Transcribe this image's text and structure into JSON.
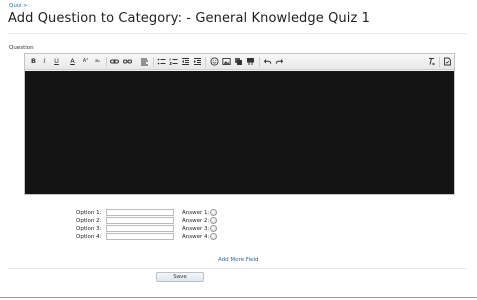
{
  "breadcrumb": {
    "link": "Quiz",
    "sep": ">"
  },
  "page": {
    "title": "Add Question to Category: - General Knowledge Quiz 1"
  },
  "question": {
    "label": "Question"
  },
  "toolbar": {
    "bold": "B",
    "italic": "I",
    "underline": "U",
    "font_color": "A",
    "superscript": "A²",
    "subscript": "a₂",
    "icons": [
      "link-icon",
      "unlink-icon",
      "align-icon",
      "bulleted-list-icon",
      "numbered-list-icon",
      "outdent-icon",
      "indent-icon",
      "smiley-icon",
      "image-icon",
      "copy-icon",
      "insert-icon",
      "undo-icon",
      "redo-icon",
      "remove-format-icon",
      "source-icon"
    ]
  },
  "options": [
    {
      "label": "Option 1:",
      "value": "",
      "answer_label": "Answer 1:"
    },
    {
      "label": "Option 2:",
      "value": "",
      "answer_label": "Answer 2:"
    },
    {
      "label": "Option 3:",
      "value": "",
      "answer_label": "Answer 3:"
    },
    {
      "label": "Option 4:",
      "value": "",
      "answer_label": "Answer 4:"
    }
  ],
  "add_more": "Add More Field",
  "save_label": "Save"
}
